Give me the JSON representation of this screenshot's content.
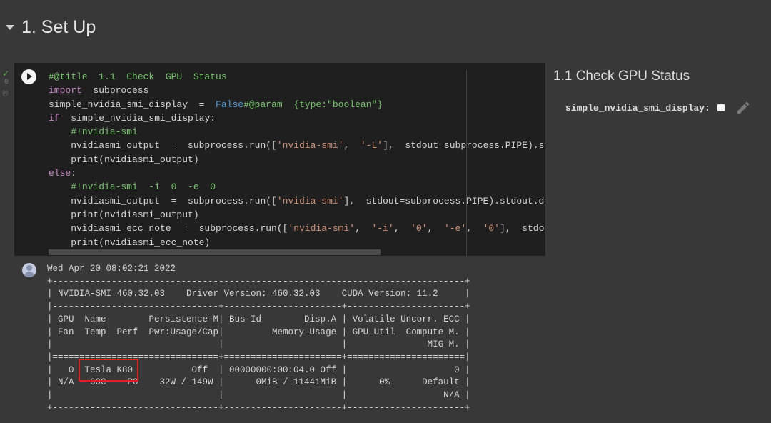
{
  "section": {
    "title": "1. Set Up"
  },
  "gutter": {
    "status": "✓",
    "count": "0",
    "elapsed": "秒"
  },
  "code_cell": {
    "lines": [
      [
        [
          "tk-comment",
          "#@title  1.1  Check  GPU  Status"
        ]
      ],
      [
        [
          "tk-kw",
          "import"
        ],
        [
          "tk-plain",
          "  subprocess"
        ]
      ],
      [
        [
          "tk-plain",
          "simple_nvidia_smi_display  =  "
        ],
        [
          "tk-bool",
          "False"
        ],
        [
          "tk-comment",
          "#@param  {type:\"boolean\"}"
        ]
      ],
      [
        [
          "tk-kw",
          "if"
        ],
        [
          "tk-plain",
          "  simple_nvidia_smi_display:"
        ]
      ],
      [
        [
          "tk-plain",
          "    "
        ],
        [
          "tk-comment",
          "#!nvidia-smi"
        ]
      ],
      [
        [
          "tk-plain",
          "    nvidiasmi_output  =  subprocess.run(["
        ],
        [
          "tk-str",
          "'nvidia-smi'"
        ],
        [
          "tk-plain",
          ",  "
        ],
        [
          "tk-str",
          "'-L'"
        ],
        [
          "tk-plain",
          "],  stdout=subprocess.PIPE).stdout"
        ]
      ],
      [
        [
          "tk-plain",
          "    print(nvidiasmi_output)"
        ]
      ],
      [
        [
          "tk-kw",
          "else"
        ],
        [
          "tk-plain",
          ":"
        ]
      ],
      [
        [
          "tk-plain",
          "    "
        ],
        [
          "tk-comment",
          "#!nvidia-smi  -i  0  -e  0"
        ]
      ],
      [
        [
          "tk-plain",
          "    nvidiasmi_output  =  subprocess.run(["
        ],
        [
          "tk-str",
          "'nvidia-smi'"
        ],
        [
          "tk-plain",
          "],  stdout=subprocess.PIPE).stdout.decode"
        ]
      ],
      [
        [
          "tk-plain",
          "    print(nvidiasmi_output)"
        ]
      ],
      [
        [
          "tk-plain",
          "    nvidiasmi_ecc_note  =  subprocess.run(["
        ],
        [
          "tk-str",
          "'nvidia-smi'"
        ],
        [
          "tk-plain",
          ",  "
        ],
        [
          "tk-str",
          "'-i'"
        ],
        [
          "tk-plain",
          ",  "
        ],
        [
          "tk-str",
          "'0'"
        ],
        [
          "tk-plain",
          ",  "
        ],
        [
          "tk-str",
          "'-e'"
        ],
        [
          "tk-plain",
          ",  "
        ],
        [
          "tk-str",
          "'0'"
        ],
        [
          "tk-plain",
          "],  stdout=su"
        ]
      ],
      [
        [
          "tk-plain",
          "    print(nvidiasmi_ecc_note)"
        ]
      ]
    ]
  },
  "form": {
    "title": "1.1 Check GPU Status",
    "param_label": "simple_nvidia_smi_display:",
    "param_value": false,
    "icons": {
      "edit": "pencil-icon",
      "run": "play-icon",
      "collapse": "caret-down-icon"
    }
  },
  "output": {
    "lines": [
      "Wed Apr 20 08:02:21 2022",
      "+-----------------------------------------------------------------------------+",
      "| NVIDIA-SMI 460.32.03    Driver Version: 460.32.03    CUDA Version: 11.2     |",
      "|-------------------------------+----------------------+----------------------+",
      "| GPU  Name        Persistence-M| Bus-Id        Disp.A | Volatile Uncorr. ECC |",
      "| Fan  Temp  Perf  Pwr:Usage/Cap|         Memory-Usage | GPU-Util  Compute M. |",
      "|                               |                      |               MIG M. |",
      "|===============================+======================+======================|",
      "|   0  Tesla K80           Off  | 00000000:00:04.0 Off |                    0 |",
      "| N/A   60C    P8    32W / 149W |      0MiB / 11441MiB |      0%      Default |",
      "|                               |                      |                  N/A |",
      "+-------------------------------+----------------------+----------------------+"
    ],
    "highlighted_text": "Tesla K80",
    "highlight_color": "#e02020"
  }
}
